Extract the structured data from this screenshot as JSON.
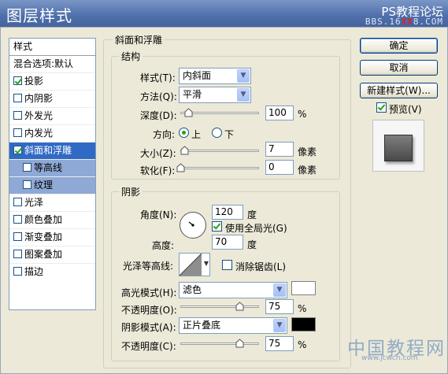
{
  "window": {
    "title": "图层样式",
    "watermark_top": "PS教程论坛",
    "watermark_url_pre": "BBS.16",
    "watermark_url_mid": "XX",
    "watermark_url_post": "8.COM"
  },
  "sidebar": {
    "header": "样式",
    "blend_options": "混合选项:默认",
    "items": [
      {
        "label": "投影",
        "checked": true
      },
      {
        "label": "内阴影",
        "checked": false
      },
      {
        "label": "外发光",
        "checked": false
      },
      {
        "label": "内发光",
        "checked": false
      },
      {
        "label": "斜面和浮雕",
        "checked": true,
        "selected": true
      },
      {
        "label": "等高线",
        "checked": false,
        "sub": true
      },
      {
        "label": "纹理",
        "checked": false,
        "sub": true
      },
      {
        "label": "光泽",
        "checked": false
      },
      {
        "label": "颜色叠加",
        "checked": false
      },
      {
        "label": "渐变叠加",
        "checked": false
      },
      {
        "label": "图案叠加",
        "checked": false
      },
      {
        "label": "描边",
        "checked": false
      }
    ]
  },
  "panel": {
    "title": "斜面和浮雕",
    "structure": {
      "title": "结构",
      "style_label": "样式(T):",
      "style_value": "内斜面",
      "technique_label": "方法(Q):",
      "technique_value": "平滑",
      "depth_label": "深度(D):",
      "depth_value": "100",
      "depth_unit": "%",
      "depth_slider_fraction": 0.1,
      "direction_label": "方向:",
      "direction_up": "上",
      "direction_down": "下",
      "size_label": "大小(Z):",
      "size_value": "7",
      "size_unit": "像素",
      "size_slider_fraction": 0.05,
      "soften_label": "软化(F):",
      "soften_value": "0",
      "soften_unit": "像素",
      "soften_slider_fraction": 0.0
    },
    "shading": {
      "title": "阴影",
      "angle_label": "角度(N):",
      "angle_value": "120",
      "angle_unit": "度",
      "global_light_label": "使用全局光(G)",
      "altitude_label": "高度:",
      "altitude_value": "70",
      "altitude_unit": "度",
      "gloss_contour_label": "光泽等高线:",
      "anti_aliased_label": "消除锯齿(L)",
      "highlight_mode_label": "高光模式(H):",
      "highlight_mode_value": "滤色",
      "highlight_color": "#ffffff",
      "highlight_opacity_label": "不透明度(O):",
      "highlight_opacity_value": "75",
      "highlight_opacity_unit": "%",
      "highlight_opacity_fraction": 0.75,
      "shadow_mode_label": "阴影模式(A):",
      "shadow_mode_value": "正片叠底",
      "shadow_color": "#000000",
      "shadow_opacity_label": "不透明度(C):",
      "shadow_opacity_value": "75",
      "shadow_opacity_unit": "%",
      "shadow_opacity_fraction": 0.75
    }
  },
  "buttons": {
    "ok": "确定",
    "cancel": "取消",
    "new_style": "新建样式(W)...",
    "preview_label": "预览(V)"
  },
  "watermark_bottom": {
    "text": "中国教程网",
    "url": "www.jcwcn.com"
  }
}
